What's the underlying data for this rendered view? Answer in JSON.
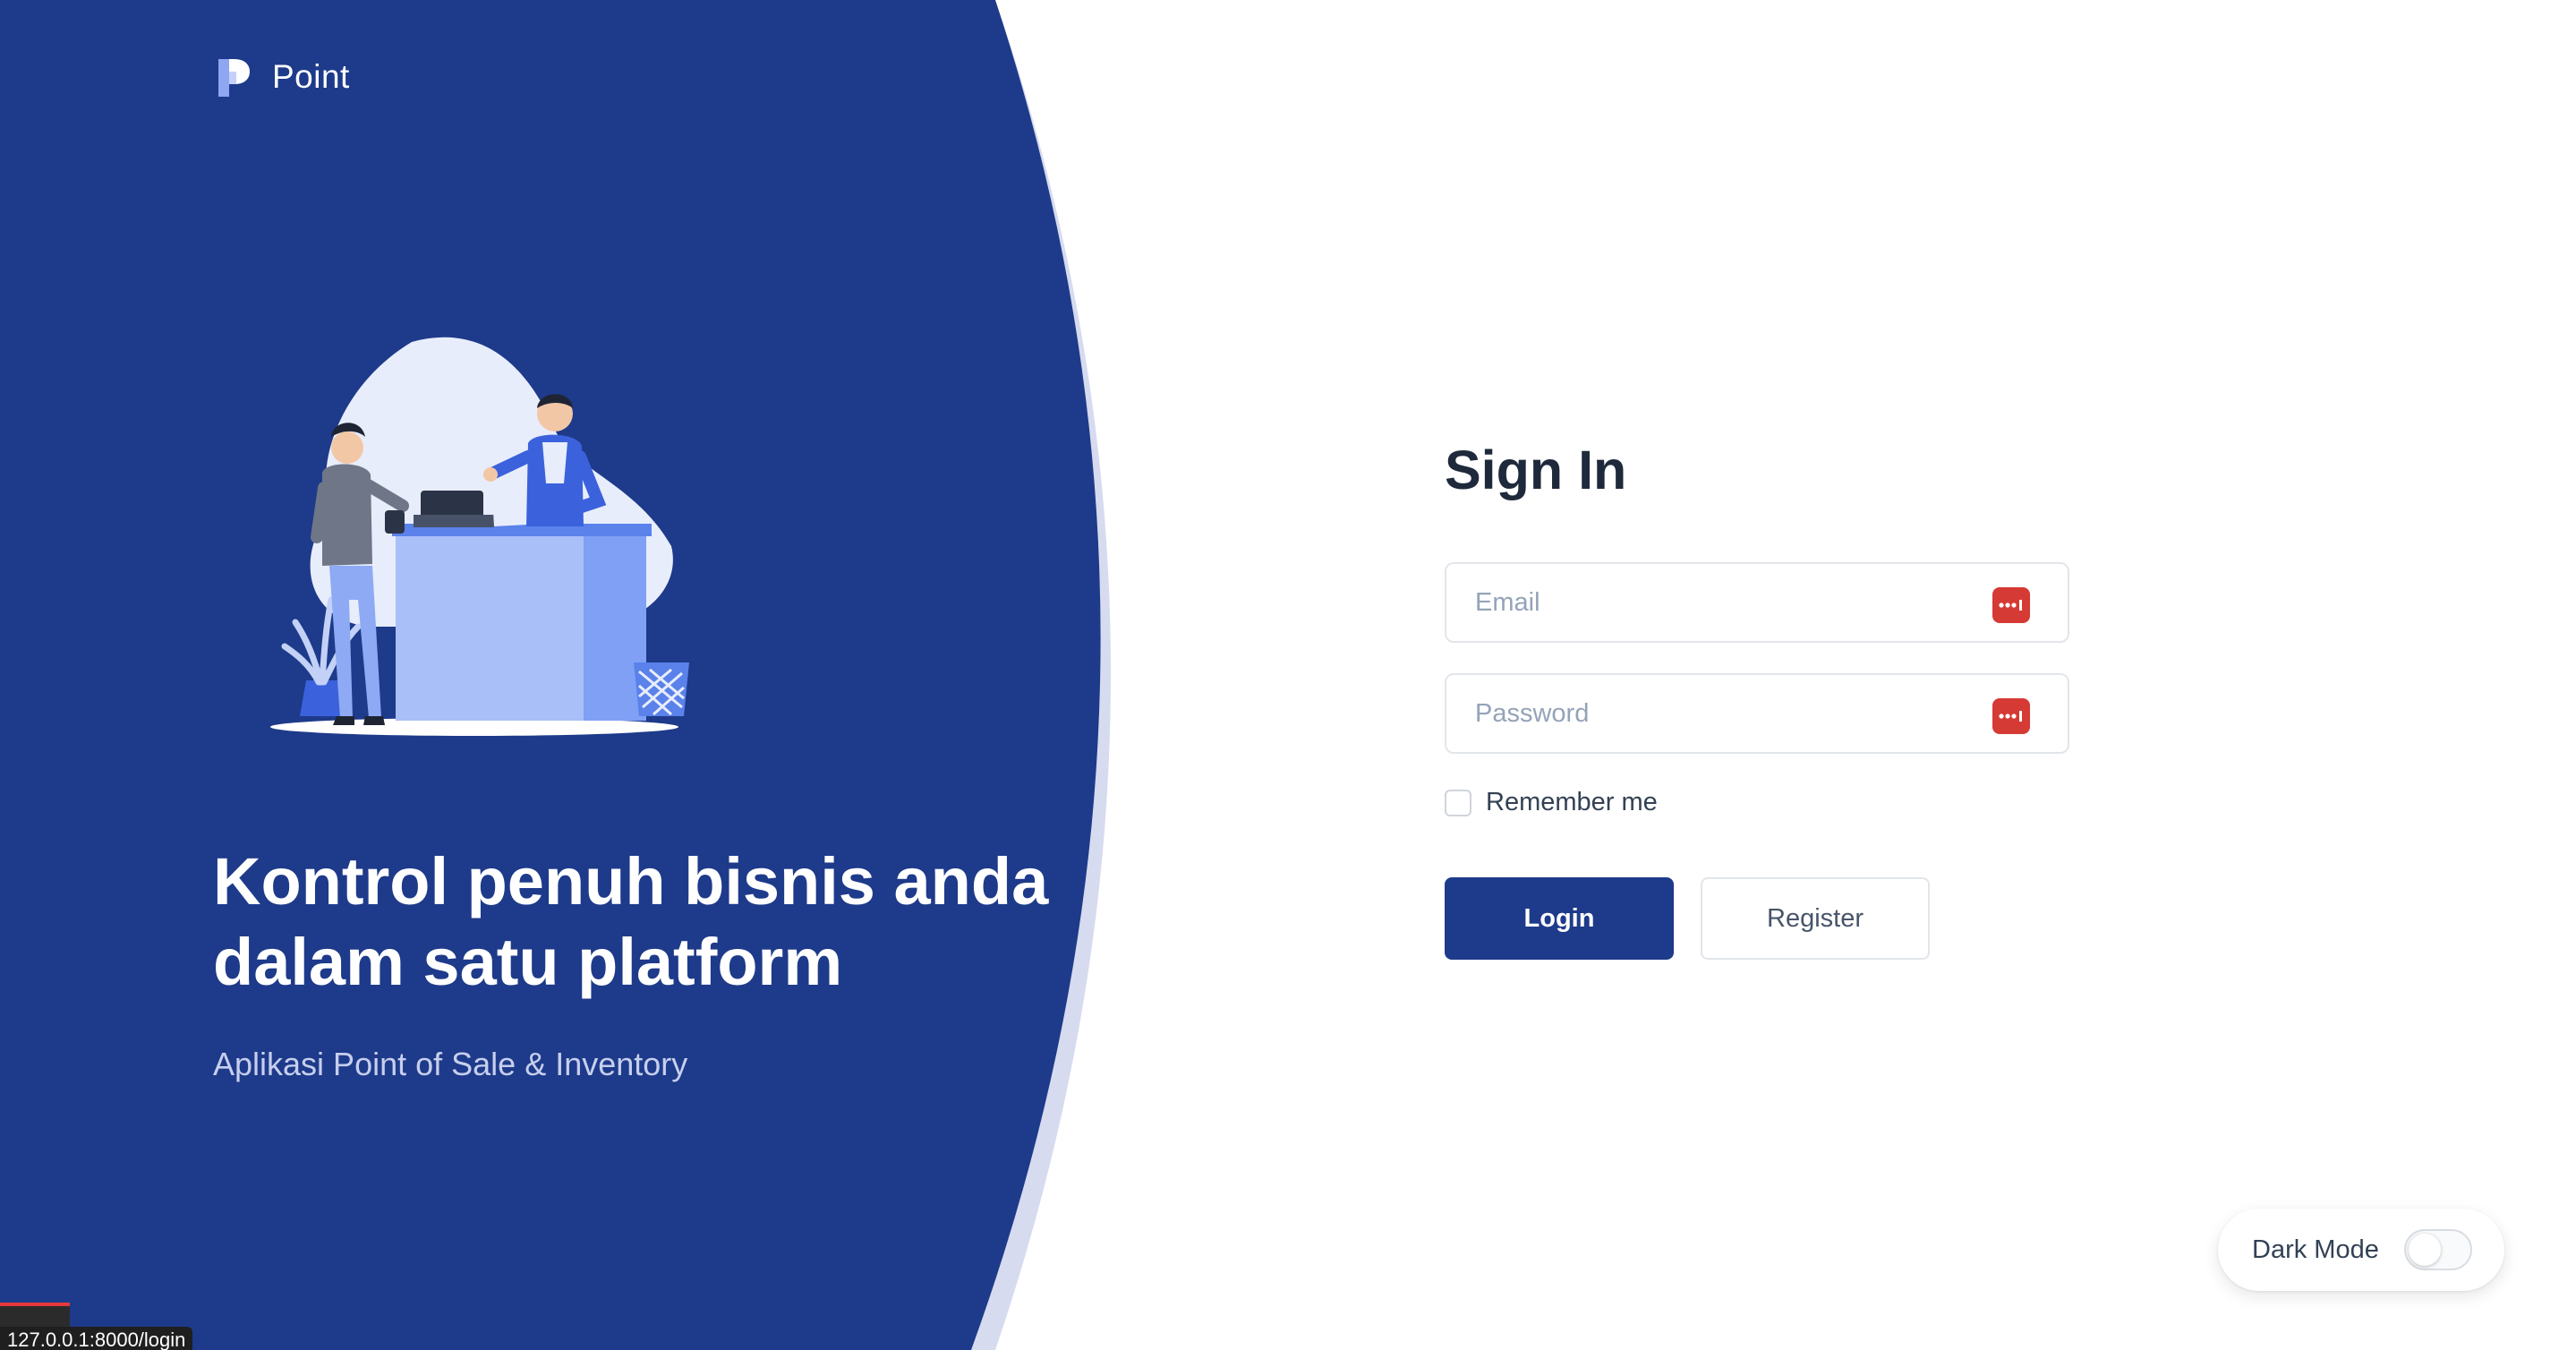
{
  "brand": {
    "name": "Point"
  },
  "hero": {
    "headline_line1": "Kontrol penuh bisnis anda",
    "headline_line2": "dalam satu platform",
    "subtitle": "Aplikasi Point of Sale & Inventory"
  },
  "form": {
    "title": "Sign In",
    "email": {
      "placeholder": "Email",
      "value": ""
    },
    "password": {
      "placeholder": "Password",
      "value": ""
    },
    "remember_label": "Remember me",
    "remember_checked": false,
    "login_label": "Login",
    "register_label": "Register"
  },
  "dark_mode": {
    "label": "Dark Mode",
    "enabled": false
  },
  "status_bar": {
    "url": "127.0.0.1:8000/login"
  },
  "colors": {
    "primary": "#1e3a8a",
    "curve_accent": "#d6dbef",
    "password_manager_icon": "#d63a34",
    "heading_text": "#1e293b"
  },
  "icons": {
    "brand": "point-logo-icon",
    "password_manager": "password-manager-icon"
  }
}
